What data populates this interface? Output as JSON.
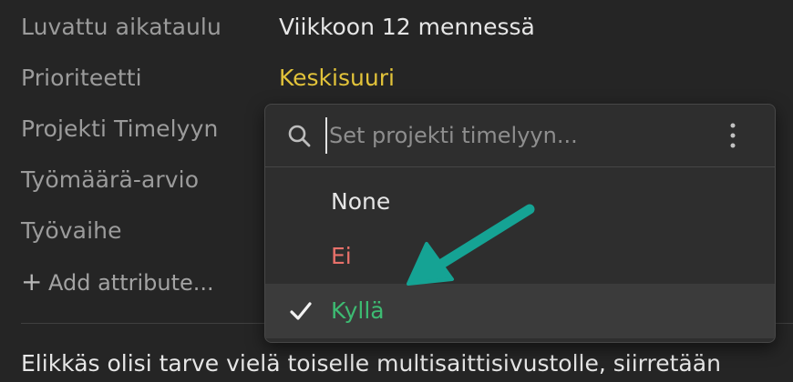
{
  "colors": {
    "background": "#252525",
    "label": "#9b9b9b",
    "value": "#e6e6e6",
    "priority": "#e2c33a",
    "option_ei": "#e8716a",
    "option_kylla": "#3dbb72",
    "arrow": "#15a394"
  },
  "attributes": [
    {
      "label": "Luvattu aikataulu",
      "value": "Viikkoon 12 mennessä"
    },
    {
      "label": "Prioriteetti",
      "value": "Keskisuuri"
    },
    {
      "label": "Projekti Timelyyn",
      "value": ""
    },
    {
      "label": "Työmäärä-arvio",
      "value": ""
    },
    {
      "label": "Työvaihe",
      "value": ""
    }
  ],
  "add_attribute": {
    "icon": "plus-icon",
    "label": "Add attribute..."
  },
  "body_text": "Elikkäs olisi tarve vielä toiselle multisaittisivustolle, siirretään",
  "dropdown": {
    "search_icon": "search-icon",
    "search_placeholder": "Set projekti timelyyn...",
    "search_value": "",
    "more_icon": "more-vertical-icon",
    "options": [
      {
        "label": "None",
        "selected": false
      },
      {
        "label": "Ei",
        "selected": false
      },
      {
        "label": "Kyllä",
        "selected": true,
        "icon": "check-icon"
      }
    ]
  },
  "annotation": {
    "icon": "arrow-pointer-icon"
  }
}
